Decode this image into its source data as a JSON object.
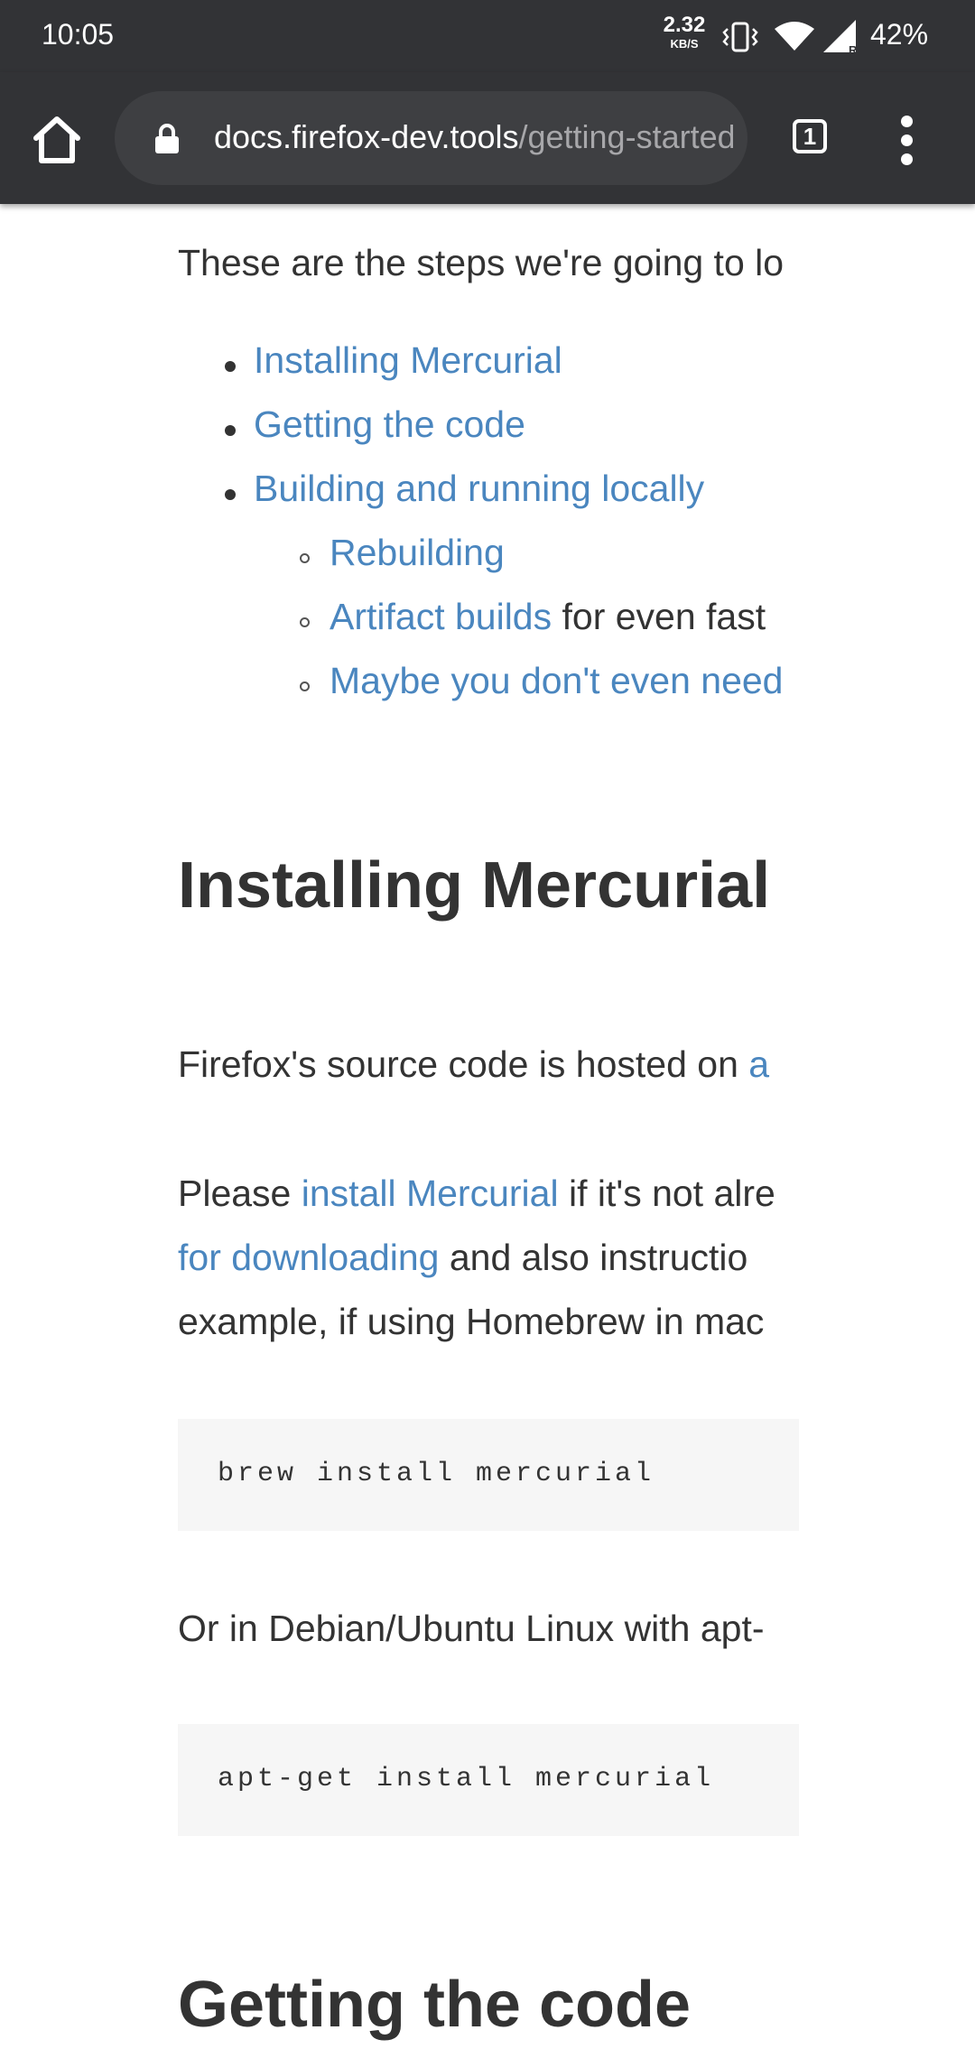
{
  "status_bar": {
    "time": "10:05",
    "speed_value": "2.32",
    "speed_unit": "KB/S",
    "battery": "42%"
  },
  "toolbar": {
    "url_host": "docs.firefox-dev.tools",
    "url_path": "/getting-started",
    "tab_count": "1"
  },
  "content": {
    "intro": "These are the steps we're going to lo",
    "toc": [
      {
        "label": "Installing Mercurial"
      },
      {
        "label": "Getting the code"
      },
      {
        "label": "Building and running locally"
      }
    ],
    "subtoc": [
      {
        "label": "Rebuilding",
        "suffix": ""
      },
      {
        "label": "Artifact builds",
        "suffix": " for even fast"
      },
      {
        "label": "Maybe you don't even need",
        "suffix": ""
      }
    ],
    "heading_installing": "Installing Mercurial",
    "hosted_text": "Firefox's source code is hosted on ",
    "hosted_link": "a",
    "please_text": "Please ",
    "install_link": "install Mercurial",
    "please_rest": " if it's not alre",
    "downloading_link": "for downloading",
    "downloading_rest": " and also instructio",
    "example_text": "example, if using Homebrew in mac",
    "code_brew": "brew install mercurial",
    "debian_text": "Or in Debian/Ubuntu Linux with apt-",
    "code_apt": "apt-get install mercurial",
    "heading_getting": "Getting the code"
  },
  "colors": {
    "chrome_bg": "#323336",
    "url_field_bg": "#3e3f42",
    "link": "#4a86bf",
    "text": "#333333",
    "code_bg": "#f6f6f6"
  }
}
